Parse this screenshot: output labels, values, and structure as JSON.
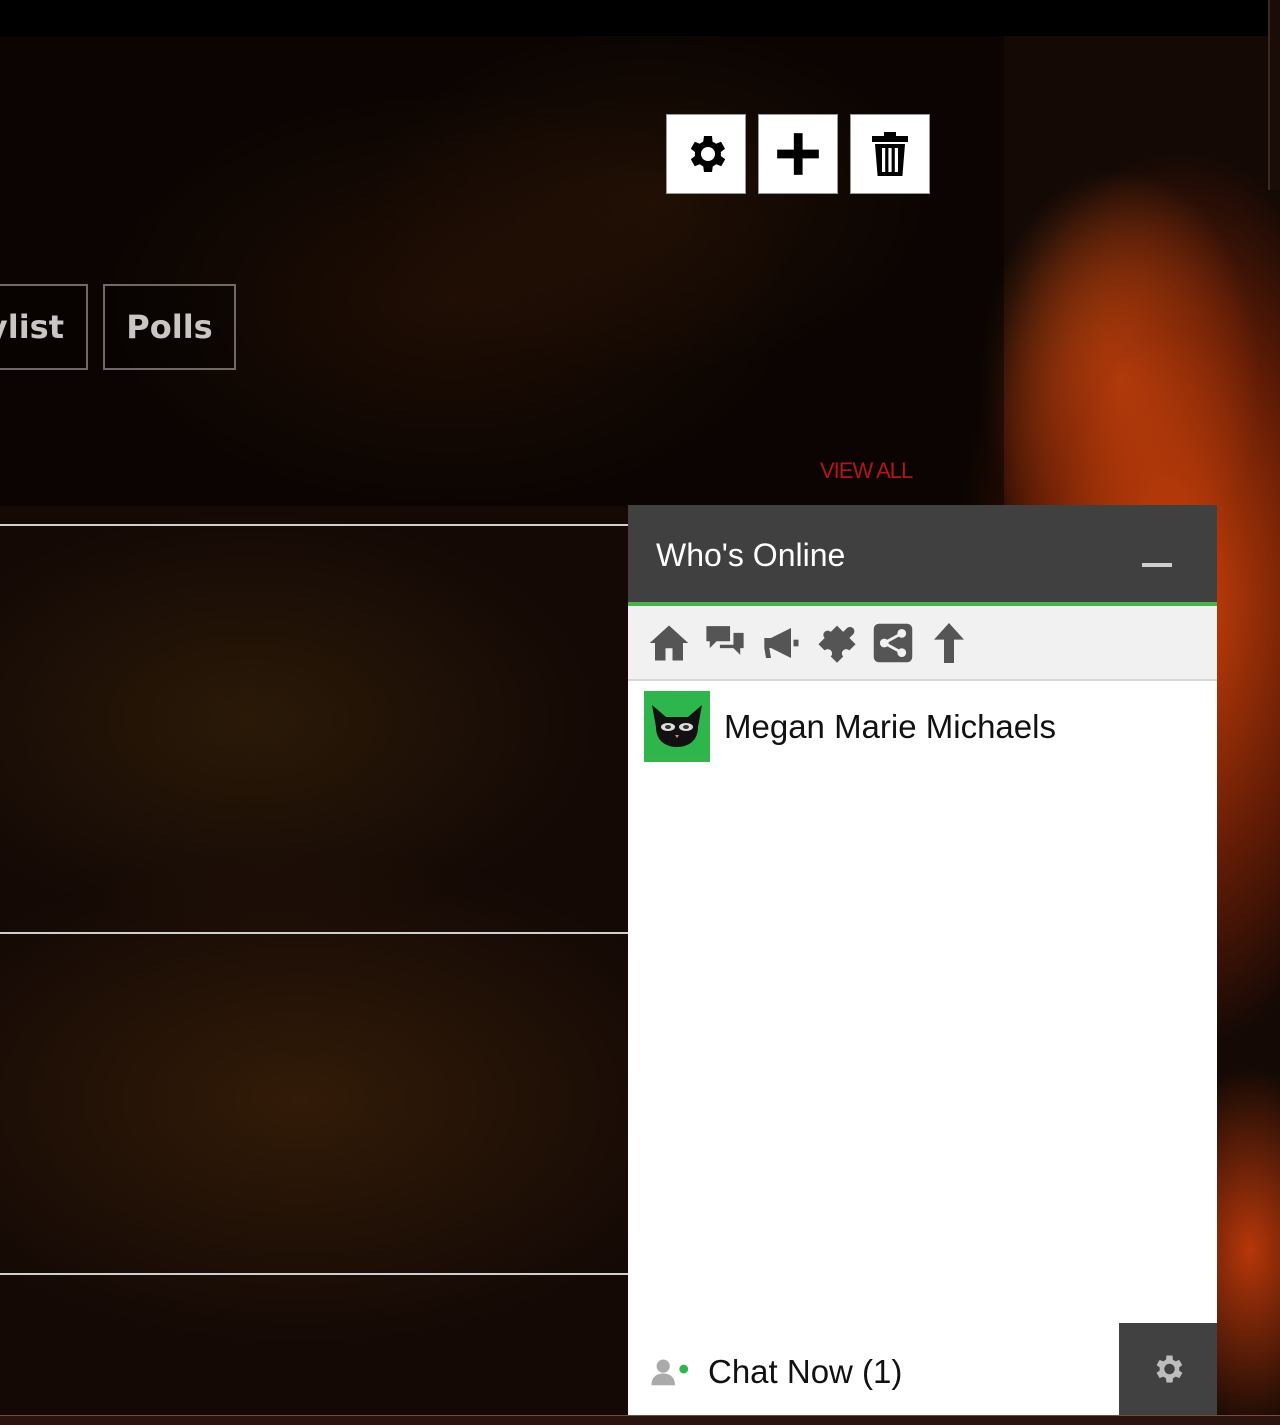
{
  "toolbar": {
    "settings_icon": "gear-icon",
    "add_icon": "plus-icon",
    "delete_icon": "trash-icon"
  },
  "tabs": [
    {
      "label": "ylist"
    },
    {
      "label": "Polls"
    }
  ],
  "view_all": "VIEW ALL",
  "chat": {
    "title": "Who's Online",
    "toolbar_icons": [
      "home-icon",
      "chat-bubbles-icon",
      "megaphone-icon",
      "puzzle-icon",
      "share-icon",
      "arrow-up-icon"
    ],
    "users": [
      {
        "name": "Megan Marie Michaels",
        "status_color": "#2eb54c"
      }
    ],
    "footer": {
      "chat_now_label": "Chat Now (1)",
      "online_dot_color": "#2eb54c"
    }
  },
  "colors": {
    "accent_green": "#4caf50",
    "view_all_red": "#b01818",
    "header_gray": "#404040"
  }
}
